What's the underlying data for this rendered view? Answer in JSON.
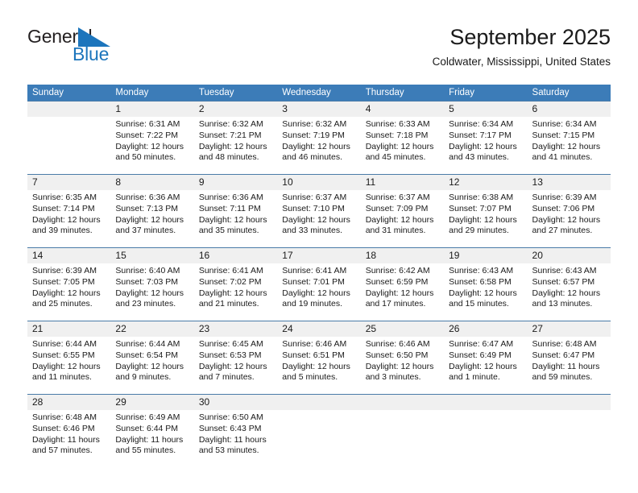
{
  "brand": {
    "name_part1": "General",
    "name_part2": "Blue",
    "mark_color": "#1c75bc",
    "text_color": "#231f20"
  },
  "header": {
    "title": "September 2025",
    "subtitle": "Coldwater, Mississippi, United States",
    "header_bg": "#3c7cb8",
    "row_band_bg": "#f0f0f0"
  },
  "weekdays": [
    "Sunday",
    "Monday",
    "Tuesday",
    "Wednesday",
    "Thursday",
    "Friday",
    "Saturday"
  ],
  "weeks": [
    {
      "days": [
        {
          "num": "",
          "sunrise": "",
          "sunset": "",
          "daylight1": "",
          "daylight2": ""
        },
        {
          "num": "1",
          "sunrise": "Sunrise: 6:31 AM",
          "sunset": "Sunset: 7:22 PM",
          "daylight1": "Daylight: 12 hours",
          "daylight2": "and 50 minutes."
        },
        {
          "num": "2",
          "sunrise": "Sunrise: 6:32 AM",
          "sunset": "Sunset: 7:21 PM",
          "daylight1": "Daylight: 12 hours",
          "daylight2": "and 48 minutes."
        },
        {
          "num": "3",
          "sunrise": "Sunrise: 6:32 AM",
          "sunset": "Sunset: 7:19 PM",
          "daylight1": "Daylight: 12 hours",
          "daylight2": "and 46 minutes."
        },
        {
          "num": "4",
          "sunrise": "Sunrise: 6:33 AM",
          "sunset": "Sunset: 7:18 PM",
          "daylight1": "Daylight: 12 hours",
          "daylight2": "and 45 minutes."
        },
        {
          "num": "5",
          "sunrise": "Sunrise: 6:34 AM",
          "sunset": "Sunset: 7:17 PM",
          "daylight1": "Daylight: 12 hours",
          "daylight2": "and 43 minutes."
        },
        {
          "num": "6",
          "sunrise": "Sunrise: 6:34 AM",
          "sunset": "Sunset: 7:15 PM",
          "daylight1": "Daylight: 12 hours",
          "daylight2": "and 41 minutes."
        }
      ]
    },
    {
      "days": [
        {
          "num": "7",
          "sunrise": "Sunrise: 6:35 AM",
          "sunset": "Sunset: 7:14 PM",
          "daylight1": "Daylight: 12 hours",
          "daylight2": "and 39 minutes."
        },
        {
          "num": "8",
          "sunrise": "Sunrise: 6:36 AM",
          "sunset": "Sunset: 7:13 PM",
          "daylight1": "Daylight: 12 hours",
          "daylight2": "and 37 minutes."
        },
        {
          "num": "9",
          "sunrise": "Sunrise: 6:36 AM",
          "sunset": "Sunset: 7:11 PM",
          "daylight1": "Daylight: 12 hours",
          "daylight2": "and 35 minutes."
        },
        {
          "num": "10",
          "sunrise": "Sunrise: 6:37 AM",
          "sunset": "Sunset: 7:10 PM",
          "daylight1": "Daylight: 12 hours",
          "daylight2": "and 33 minutes."
        },
        {
          "num": "11",
          "sunrise": "Sunrise: 6:37 AM",
          "sunset": "Sunset: 7:09 PM",
          "daylight1": "Daylight: 12 hours",
          "daylight2": "and 31 minutes."
        },
        {
          "num": "12",
          "sunrise": "Sunrise: 6:38 AM",
          "sunset": "Sunset: 7:07 PM",
          "daylight1": "Daylight: 12 hours",
          "daylight2": "and 29 minutes."
        },
        {
          "num": "13",
          "sunrise": "Sunrise: 6:39 AM",
          "sunset": "Sunset: 7:06 PM",
          "daylight1": "Daylight: 12 hours",
          "daylight2": "and 27 minutes."
        }
      ]
    },
    {
      "days": [
        {
          "num": "14",
          "sunrise": "Sunrise: 6:39 AM",
          "sunset": "Sunset: 7:05 PM",
          "daylight1": "Daylight: 12 hours",
          "daylight2": "and 25 minutes."
        },
        {
          "num": "15",
          "sunrise": "Sunrise: 6:40 AM",
          "sunset": "Sunset: 7:03 PM",
          "daylight1": "Daylight: 12 hours",
          "daylight2": "and 23 minutes."
        },
        {
          "num": "16",
          "sunrise": "Sunrise: 6:41 AM",
          "sunset": "Sunset: 7:02 PM",
          "daylight1": "Daylight: 12 hours",
          "daylight2": "and 21 minutes."
        },
        {
          "num": "17",
          "sunrise": "Sunrise: 6:41 AM",
          "sunset": "Sunset: 7:01 PM",
          "daylight1": "Daylight: 12 hours",
          "daylight2": "and 19 minutes."
        },
        {
          "num": "18",
          "sunrise": "Sunrise: 6:42 AM",
          "sunset": "Sunset: 6:59 PM",
          "daylight1": "Daylight: 12 hours",
          "daylight2": "and 17 minutes."
        },
        {
          "num": "19",
          "sunrise": "Sunrise: 6:43 AM",
          "sunset": "Sunset: 6:58 PM",
          "daylight1": "Daylight: 12 hours",
          "daylight2": "and 15 minutes."
        },
        {
          "num": "20",
          "sunrise": "Sunrise: 6:43 AM",
          "sunset": "Sunset: 6:57 PM",
          "daylight1": "Daylight: 12 hours",
          "daylight2": "and 13 minutes."
        }
      ]
    },
    {
      "days": [
        {
          "num": "21",
          "sunrise": "Sunrise: 6:44 AM",
          "sunset": "Sunset: 6:55 PM",
          "daylight1": "Daylight: 12 hours",
          "daylight2": "and 11 minutes."
        },
        {
          "num": "22",
          "sunrise": "Sunrise: 6:44 AM",
          "sunset": "Sunset: 6:54 PM",
          "daylight1": "Daylight: 12 hours",
          "daylight2": "and 9 minutes."
        },
        {
          "num": "23",
          "sunrise": "Sunrise: 6:45 AM",
          "sunset": "Sunset: 6:53 PM",
          "daylight1": "Daylight: 12 hours",
          "daylight2": "and 7 minutes."
        },
        {
          "num": "24",
          "sunrise": "Sunrise: 6:46 AM",
          "sunset": "Sunset: 6:51 PM",
          "daylight1": "Daylight: 12 hours",
          "daylight2": "and 5 minutes."
        },
        {
          "num": "25",
          "sunrise": "Sunrise: 6:46 AM",
          "sunset": "Sunset: 6:50 PM",
          "daylight1": "Daylight: 12 hours",
          "daylight2": "and 3 minutes."
        },
        {
          "num": "26",
          "sunrise": "Sunrise: 6:47 AM",
          "sunset": "Sunset: 6:49 PM",
          "daylight1": "Daylight: 12 hours",
          "daylight2": "and 1 minute."
        },
        {
          "num": "27",
          "sunrise": "Sunrise: 6:48 AM",
          "sunset": "Sunset: 6:47 PM",
          "daylight1": "Daylight: 11 hours",
          "daylight2": "and 59 minutes."
        }
      ]
    },
    {
      "days": [
        {
          "num": "28",
          "sunrise": "Sunrise: 6:48 AM",
          "sunset": "Sunset: 6:46 PM",
          "daylight1": "Daylight: 11 hours",
          "daylight2": "and 57 minutes."
        },
        {
          "num": "29",
          "sunrise": "Sunrise: 6:49 AM",
          "sunset": "Sunset: 6:44 PM",
          "daylight1": "Daylight: 11 hours",
          "daylight2": "and 55 minutes."
        },
        {
          "num": "30",
          "sunrise": "Sunrise: 6:50 AM",
          "sunset": "Sunset: 6:43 PM",
          "daylight1": "Daylight: 11 hours",
          "daylight2": "and 53 minutes."
        },
        {
          "num": "",
          "sunrise": "",
          "sunset": "",
          "daylight1": "",
          "daylight2": ""
        },
        {
          "num": "",
          "sunrise": "",
          "sunset": "",
          "daylight1": "",
          "daylight2": ""
        },
        {
          "num": "",
          "sunrise": "",
          "sunset": "",
          "daylight1": "",
          "daylight2": ""
        },
        {
          "num": "",
          "sunrise": "",
          "sunset": "",
          "daylight1": "",
          "daylight2": ""
        }
      ]
    }
  ]
}
